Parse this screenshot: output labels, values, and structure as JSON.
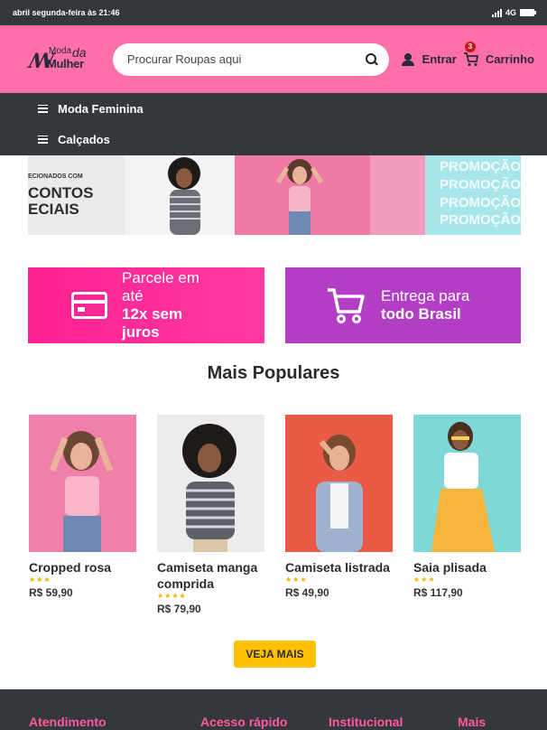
{
  "status_bar": {
    "left_text": "abril segunda-feira às 21:46",
    "network": "4G"
  },
  "header": {
    "logo": {
      "text_top": "Moda",
      "text_da": "da",
      "text_bottom": "Mulher"
    },
    "search": {
      "placeholder": "Procurar Roupas aqui"
    },
    "login_label": "Entrar",
    "cart_label": "Carrinho",
    "cart_count": "3",
    "brand_color": "#ff6fa8"
  },
  "category_nav": {
    "items": [
      {
        "label": "Moda Feminina"
      },
      {
        "label": "Calçados"
      }
    ]
  },
  "banner": {
    "small_text": "ECIONADOS COM",
    "big_text_1": "CONTOS",
    "big_text_2": "ECIAIS",
    "promo_words": [
      "PROMOÇÃO",
      "PROMOÇÃO",
      "PROMOÇÃO",
      "PROMOÇÃO"
    ]
  },
  "promos": [
    {
      "line1": "Parcele em",
      "line2": "até",
      "bold1": "12x sem",
      "bold2": "juros",
      "color": "#ff1f93"
    },
    {
      "line1": "Entrega para",
      "bold1": "todo Brasil",
      "color": "#b23ec6"
    }
  ],
  "section_title": "Mais Populares",
  "products": [
    {
      "name": "Cropped rosa",
      "stars": "★★★",
      "price": "R$ 59,90"
    },
    {
      "name": "Camiseta manga comprida",
      "stars": "★★★★",
      "price": "R$ 79,90"
    },
    {
      "name": "Camiseta listrada",
      "stars": "★★★",
      "price": "R$ 49,90"
    },
    {
      "name": "Saia plisada",
      "stars": "★★★",
      "price": "R$ 117,90"
    }
  ],
  "see_more_label": "VEJA MAIS",
  "footer": {
    "columns": [
      "Atendimento",
      "Acesso rápido",
      "Institucional",
      "Mais"
    ]
  }
}
